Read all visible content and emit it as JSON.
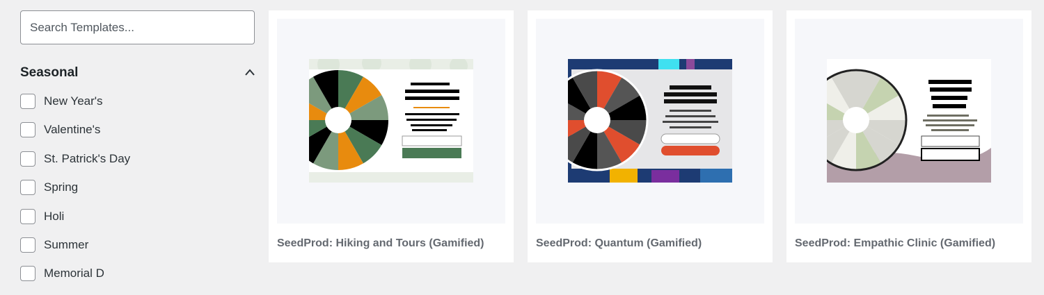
{
  "search": {
    "placeholder": "Search Templates..."
  },
  "category": {
    "title": "Seasonal",
    "items": [
      {
        "label": "New Year's",
        "checked": false
      },
      {
        "label": "Valentine's",
        "checked": false
      },
      {
        "label": "St. Patrick's Day",
        "checked": false
      },
      {
        "label": "Spring",
        "checked": false
      },
      {
        "label": "Holi",
        "checked": false
      },
      {
        "label": "Summer",
        "checked": false
      },
      {
        "label": "Memorial D",
        "checked": false
      }
    ]
  },
  "templates": [
    {
      "title": "SeedProd: Hiking and Tours (Gamified)"
    },
    {
      "title": "SeedProd: Quantum (Gamified)"
    },
    {
      "title": "SeedProd: Empathic Clinic (Gamified)"
    }
  ],
  "colors": {
    "page_bg": "#f0f0f1",
    "hiking": [
      "#4a7a55",
      "#e88b0e",
      "#7c9a7d",
      "#000000"
    ],
    "quantum": [
      "#e04e2e",
      "#555555",
      "#000000",
      "#4a4a4a"
    ],
    "clinic": [
      "#d6d6d0",
      "#c5d3b0",
      "#b39ea8"
    ]
  }
}
